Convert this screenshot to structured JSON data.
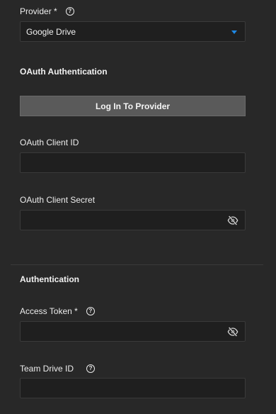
{
  "provider": {
    "label": "Provider *",
    "help": "?",
    "selected": "Google Drive"
  },
  "oauth": {
    "title": "OAuth Authentication",
    "login_button": "Log In To Provider",
    "client_id_label": "OAuth Client ID",
    "client_id_value": "",
    "client_secret_label": "OAuth Client Secret",
    "client_secret_value": ""
  },
  "auth": {
    "title": "Authentication",
    "access_token_label": "Access Token *",
    "access_token_help": "?",
    "access_token_value": "",
    "team_drive_label": "Team Drive ID",
    "team_drive_help": "?",
    "team_drive_value": ""
  },
  "colors": {
    "background": "#282828",
    "field": "#1f1f1f",
    "button": "#5a5a5a",
    "accent": "#1e88e5"
  },
  "icons": {
    "help": "question-circle-icon",
    "visibility": "eye-off-icon",
    "dropdown": "caret-down-icon"
  }
}
